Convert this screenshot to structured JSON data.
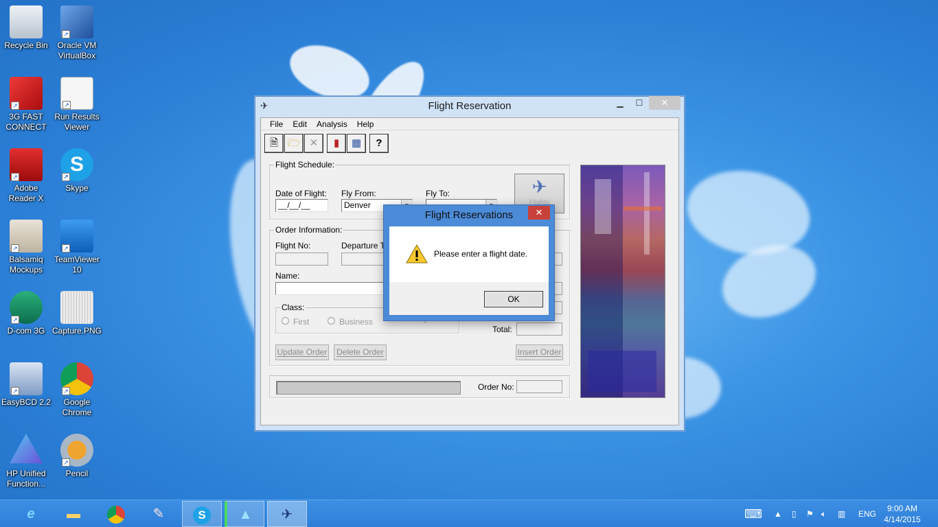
{
  "desktop": {
    "icons": [
      {
        "label": "Recycle Bin"
      },
      {
        "label": "Oracle VM VirtualBox"
      },
      {
        "label": "3G FAST CONNECT"
      },
      {
        "label": "Run Results Viewer"
      },
      {
        "label": "Adobe Reader X"
      },
      {
        "label": "Skype"
      },
      {
        "label": "Balsamiq Mockups"
      },
      {
        "label": "TeamViewer 10"
      },
      {
        "label": "D-com 3G"
      },
      {
        "label": "Capture.PNG"
      },
      {
        "label": "EasyBCD 2.2"
      },
      {
        "label": "Google Chrome"
      },
      {
        "label": "HP Unified Function..."
      },
      {
        "label": "Pencil"
      }
    ]
  },
  "app": {
    "title": "Flight Reservation",
    "menu": [
      "File",
      "Edit",
      "Analysis",
      "Help"
    ],
    "toolbar": {
      "icons": [
        "new-order-icon",
        "open-order-icon",
        "delete-icon",
        "graph-icon",
        "report-icon",
        "help-icon"
      ],
      "help_glyph": "?"
    },
    "schedule": {
      "legend": "Flight Schedule:",
      "date_label": "Date of Flight:",
      "date_value": "__/__/__",
      "from_label": "Fly From:",
      "from_value": "Denver",
      "to_label": "Fly To:",
      "to_value": "",
      "flights_button": "Flights"
    },
    "order": {
      "legend": "Order Information:",
      "flight_no_label": "Flight No:",
      "departure_label": "Departure Tir",
      "name_label": "Name:",
      "class_legend": "Class:",
      "class_options": [
        "First",
        "Business",
        "Economy"
      ],
      "total_label": "Total:",
      "update_button": "Update Order",
      "delete_button": "Delete Order",
      "insert_button": "Insert Order"
    },
    "status": {
      "order_no_label": "Order No:",
      "order_no_value": ""
    }
  },
  "dialog": {
    "title": "Flight Reservations",
    "message": "Please enter a flight date.",
    "ok_label": "OK",
    "icon": "warning-icon"
  },
  "taskbar": {
    "apps": [
      "internet-explorer-icon",
      "file-explorer-icon",
      "chrome-icon",
      "balsamiq-icon",
      "skype-icon",
      "hp-unified-icon",
      "flight-reservation-icon"
    ],
    "language": "ENG",
    "time": "9:00 AM",
    "date": "4/14/2015"
  }
}
